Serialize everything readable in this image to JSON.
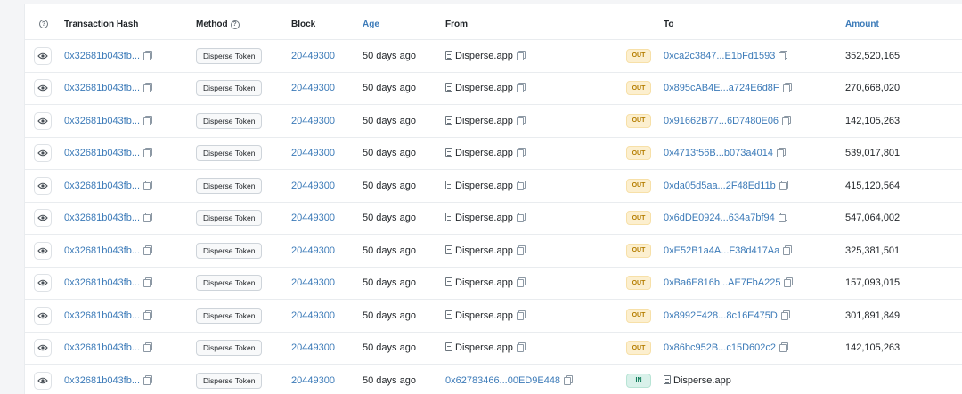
{
  "headers": {
    "hash": "Transaction Hash",
    "method": "Method",
    "block": "Block",
    "age": "Age",
    "from": "From",
    "to": "To",
    "amount": "Amount",
    "help_glyph": "?"
  },
  "rows": [
    {
      "hash": "0x32681b043fb...",
      "method": "Disperse Token",
      "block": "20449300",
      "age": "50 days ago",
      "from": "Disperse.app",
      "from_is_contract": true,
      "direction": "OUT",
      "to": "0xca2c3847...E1bFd1593",
      "amount": "352,520,165"
    },
    {
      "hash": "0x32681b043fb...",
      "method": "Disperse Token",
      "block": "20449300",
      "age": "50 days ago",
      "from": "Disperse.app",
      "from_is_contract": true,
      "direction": "OUT",
      "to": "0x895cAB4E...a724E6d8F",
      "amount": "270,668,020"
    },
    {
      "hash": "0x32681b043fb...",
      "method": "Disperse Token",
      "block": "20449300",
      "age": "50 days ago",
      "from": "Disperse.app",
      "from_is_contract": true,
      "direction": "OUT",
      "to": "0x91662B77...6D7480E06",
      "amount": "142,105,263"
    },
    {
      "hash": "0x32681b043fb...",
      "method": "Disperse Token",
      "block": "20449300",
      "age": "50 days ago",
      "from": "Disperse.app",
      "from_is_contract": true,
      "direction": "OUT",
      "to": "0x4713f56B...b073a4014",
      "amount": "539,017,801"
    },
    {
      "hash": "0x32681b043fb...",
      "method": "Disperse Token",
      "block": "20449300",
      "age": "50 days ago",
      "from": "Disperse.app",
      "from_is_contract": true,
      "direction": "OUT",
      "to": "0xda05d5aa...2F48Ed11b",
      "amount": "415,120,564"
    },
    {
      "hash": "0x32681b043fb...",
      "method": "Disperse Token",
      "block": "20449300",
      "age": "50 days ago",
      "from": "Disperse.app",
      "from_is_contract": true,
      "direction": "OUT",
      "to": "0x6dDE0924...634a7bf94",
      "amount": "547,064,002"
    },
    {
      "hash": "0x32681b043fb...",
      "method": "Disperse Token",
      "block": "20449300",
      "age": "50 days ago",
      "from": "Disperse.app",
      "from_is_contract": true,
      "direction": "OUT",
      "to": "0xE52B1a4A...F38d417Aa",
      "amount": "325,381,501"
    },
    {
      "hash": "0x32681b043fb...",
      "method": "Disperse Token",
      "block": "20449300",
      "age": "50 days ago",
      "from": "Disperse.app",
      "from_is_contract": true,
      "direction": "OUT",
      "to": "0xBa6E816b...AE7FbA225",
      "amount": "157,093,015"
    },
    {
      "hash": "0x32681b043fb...",
      "method": "Disperse Token",
      "block": "20449300",
      "age": "50 days ago",
      "from": "Disperse.app",
      "from_is_contract": true,
      "direction": "OUT",
      "to": "0x8992F428...8c16E475D",
      "amount": "301,891,849"
    },
    {
      "hash": "0x32681b043fb...",
      "method": "Disperse Token",
      "block": "20449300",
      "age": "50 days ago",
      "from": "Disperse.app",
      "from_is_contract": true,
      "direction": "OUT",
      "to": "0x86bc952B...c15D602c2",
      "amount": "142,105,263"
    },
    {
      "hash": "0x32681b043fb...",
      "method": "Disperse Token",
      "block": "20449300",
      "age": "50 days ago",
      "from": "0x62783466...00ED9E448",
      "from_is_contract": false,
      "direction": "IN",
      "to": "Disperse.app",
      "amount": ""
    }
  ],
  "colors": {
    "link": "#3b7ab8",
    "out_badge_bg": "#fcefcf",
    "in_badge_bg": "#d9f1ea"
  }
}
